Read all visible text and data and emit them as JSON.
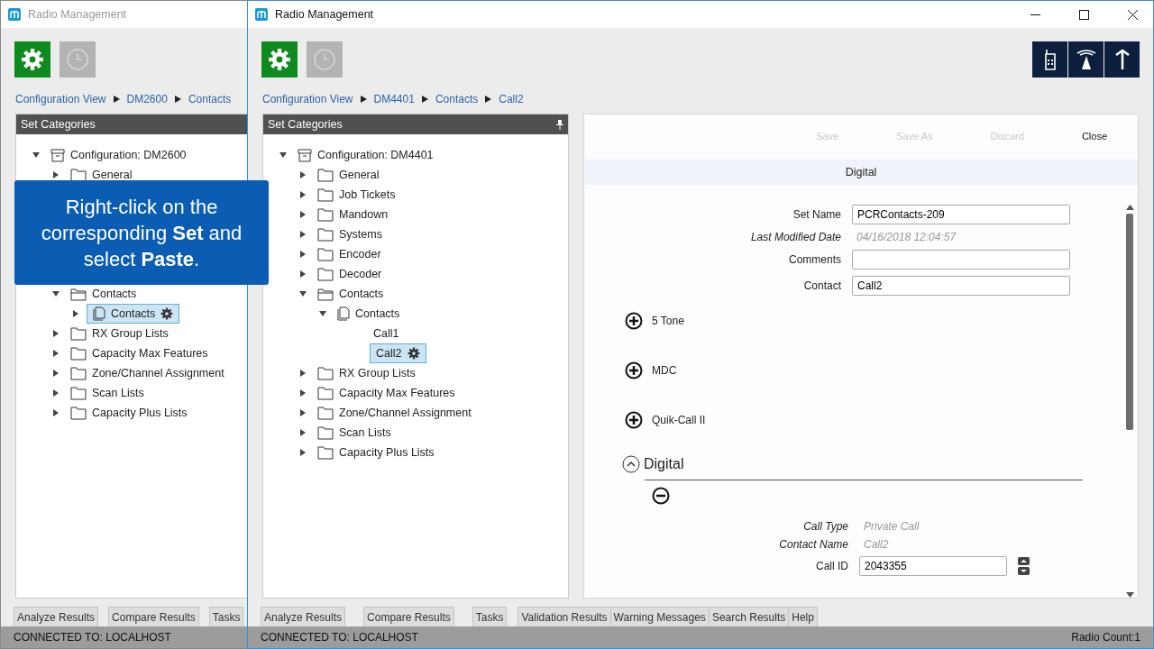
{
  "windows": [
    {
      "title": "Radio Management",
      "active": false,
      "toolbar": [
        {
          "kind": "settings",
          "selected": true
        },
        {
          "kind": "history",
          "selected": false
        }
      ],
      "breadcrumb": [
        "Configuration View",
        "DM2600",
        "Contacts"
      ],
      "panel_title": "Set Categories",
      "tree": [
        {
          "label": "Configuration: DM2600",
          "kind": "config",
          "expanded": true,
          "selected": false,
          "children": [
            {
              "label": "General",
              "kind": "folder",
              "expanded": false,
              "selected": false
            },
            {
              "label": "Contacts",
              "kind": "folder",
              "expanded": true,
              "selected": false,
              "children": [
                {
                  "label": "Contacts",
                  "kind": "set",
                  "expanded": false,
                  "selected": true
                }
              ]
            },
            {
              "label": "RX Group Lists",
              "kind": "folder",
              "expanded": false,
              "selected": false
            },
            {
              "label": "Capacity Max Features",
              "kind": "folder",
              "expanded": false,
              "selected": false
            },
            {
              "label": "Zone/Channel Assignment",
              "kind": "folder",
              "expanded": false,
              "selected": false
            },
            {
              "label": "Scan Lists",
              "kind": "folder",
              "expanded": false,
              "selected": false
            },
            {
              "label": "Capacity Plus Lists",
              "kind": "folder",
              "expanded": false,
              "selected": false
            }
          ]
        }
      ],
      "bottom_tabs": [
        "Analyze Results",
        "Compare Results",
        "Tasks"
      ],
      "status": "CONNECTED TO: LOCALHOST"
    },
    {
      "title": "Radio Management",
      "active": true,
      "toolbar": [
        {
          "kind": "settings",
          "selected": true
        },
        {
          "kind": "history",
          "selected": false
        }
      ],
      "breadcrumb": [
        "Configuration View",
        "DM4401",
        "Contacts",
        "Call2"
      ],
      "panel_title": "Set Categories",
      "tree": [
        {
          "label": "Configuration: DM4401",
          "kind": "config",
          "expanded": true,
          "selected": false,
          "children": [
            {
              "label": "General",
              "kind": "folder",
              "expanded": false,
              "selected": false
            },
            {
              "label": "Job Tickets",
              "kind": "folder",
              "expanded": false,
              "selected": false
            },
            {
              "label": "Mandown",
              "kind": "folder",
              "expanded": false,
              "selected": false
            },
            {
              "label": "Systems",
              "kind": "folder",
              "expanded": false,
              "selected": false
            },
            {
              "label": "Encoder",
              "kind": "folder",
              "expanded": false,
              "selected": false
            },
            {
              "label": "Decoder",
              "kind": "folder",
              "expanded": false,
              "selected": false
            },
            {
              "label": "Contacts",
              "kind": "folder",
              "expanded": true,
              "selected": false,
              "children": [
                {
                  "label": "Contacts",
                  "kind": "set",
                  "expanded": true,
                  "selected": false,
                  "children": [
                    {
                      "label": "Call1",
                      "kind": "leaf",
                      "selected": false
                    },
                    {
                      "label": "Call2",
                      "kind": "leaf",
                      "selected": true
                    }
                  ]
                }
              ]
            },
            {
              "label": "RX Group Lists",
              "kind": "folder",
              "expanded": false,
              "selected": false
            },
            {
              "label": "Capacity Max Features",
              "kind": "folder",
              "expanded": false,
              "selected": false
            },
            {
              "label": "Zone/Channel Assignment",
              "kind": "folder",
              "expanded": false,
              "selected": false
            },
            {
              "label": "Scan Lists",
              "kind": "folder",
              "expanded": false,
              "selected": false
            },
            {
              "label": "Capacity Plus Lists",
              "kind": "folder",
              "expanded": false,
              "selected": false
            }
          ]
        }
      ],
      "editor": {
        "actions": [
          {
            "label": "Save",
            "disabled": true
          },
          {
            "label": "Save As",
            "disabled": true
          },
          {
            "label": "Discard",
            "disabled": true
          },
          {
            "label": "Close",
            "disabled": false
          }
        ],
        "header": "Digital",
        "fields": [
          {
            "label": "Set Name",
            "kind": "input",
            "value": "PCRContacts-209"
          },
          {
            "label": "Last Modified Date",
            "kind": "readonly",
            "value": "04/16/2018 12:04:57"
          },
          {
            "label": "Comments",
            "kind": "input"
          },
          {
            "label": "Contact",
            "kind": "input",
            "value": "Call2"
          }
        ],
        "sections": [
          {
            "label": "5 Tone",
            "expanded": false
          },
          {
            "label": "MDC",
            "expanded": false
          },
          {
            "label": "Quik-Call II",
            "expanded": false
          },
          {
            "label": "Digital",
            "expanded": true,
            "fields": [
              {
                "label": "Call Type",
                "kind": "readonly",
                "value": "Private Call"
              },
              {
                "label": "Contact Name",
                "kind": "readonly",
                "value": "Call2"
              },
              {
                "label": "Call ID",
                "kind": "spinner",
                "value": "2043355"
              }
            ]
          }
        ]
      },
      "bottom_tabs": [
        "Analyze Results",
        "Compare Results",
        "Tasks",
        "Validation Results",
        "Warning Messages",
        "Search Results",
        "Help"
      ],
      "status": "CONNECTED TO: LOCALHOST",
      "radio_count": "Radio Count:1"
    }
  ],
  "callout": {
    "text": "Right-click on the corresponding **Set** and select **Paste**."
  }
}
